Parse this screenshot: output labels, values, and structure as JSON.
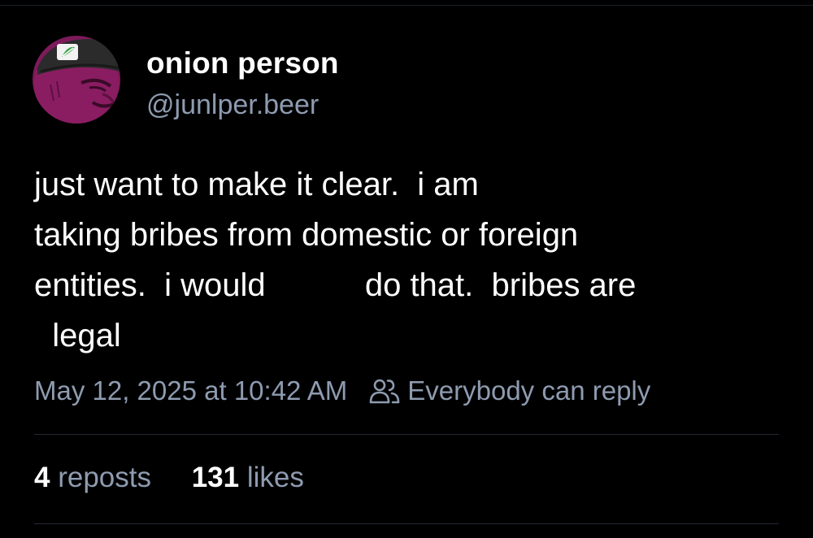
{
  "author": {
    "display_name": "onion person",
    "handle": "@junlper.beer",
    "avatar_icon": "onion-character-avatar"
  },
  "post": {
    "lines": [
      "just want to make it clear.  i am",
      "taking bribes from domestic or foreign",
      "entities.  i would           do that.  bribes are",
      "  legal"
    ],
    "timestamp": "May 12, 2025 at 10:42 AM",
    "reply_setting": "Everybody can reply",
    "reply_icon": "people-icon"
  },
  "stats": {
    "reposts_count": "4",
    "reposts_label": "reposts",
    "likes_count": "131",
    "likes_label": "likes"
  },
  "colors": {
    "background": "#000000",
    "text": "#ffffff",
    "muted": "#8e9bb0",
    "divider": "#262a33",
    "avatar_purple": "#8a1d62"
  }
}
